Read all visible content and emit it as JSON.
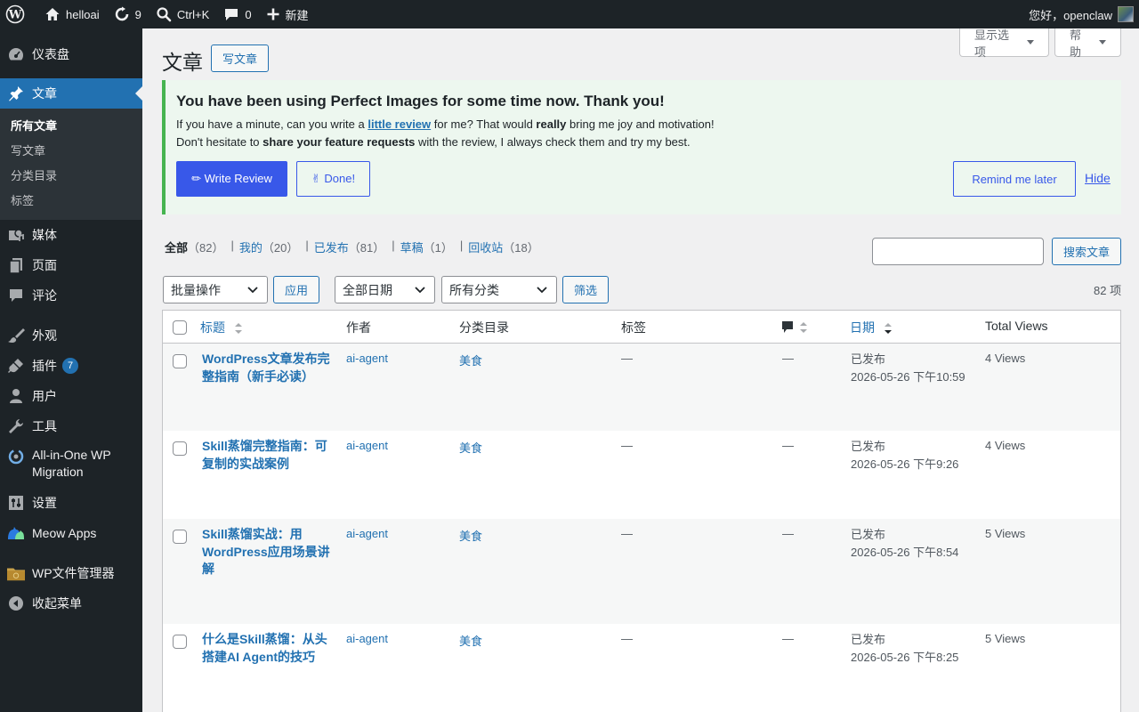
{
  "adminbar": {
    "site_name": "helloai",
    "updates_count": "9",
    "search_shortcut": "Ctrl+K",
    "comments_count": "0",
    "new_label": "新建",
    "greeting": "您好，openclaw"
  },
  "sidebar": {
    "dashboard": "仪表盘",
    "posts": "文章",
    "submenu": [
      "所有文章",
      "写文章",
      "分类目录",
      "标签"
    ],
    "media": "媒体",
    "pages": "页面",
    "comments": "评论",
    "appearance": "外观",
    "plugins": "插件",
    "plugins_badge": "7",
    "users": "用户",
    "tools": "工具",
    "migration_line1": "All-in-One WP",
    "migration_line2": "Migration",
    "settings": "设置",
    "meow": "Meow Apps",
    "file_manager": "WP文件管理器",
    "collapse": "收起菜单"
  },
  "header": {
    "screen_options": "显示选项",
    "help": "帮助",
    "title": "文章",
    "add_new": "写文章"
  },
  "notice": {
    "title": "You have been using Perfect Images for some time now. Thank you! ",
    "line1_pre": "If you have a minute, can you write a ",
    "line1_link": "little review",
    "line1_mid": " for me? That would ",
    "line1_bold": "really",
    "line1_post": " bring me joy and motivation! ",
    "line2_pre": "Don't hesitate to ",
    "line2_bold": "share your feature requests",
    "line2_post": " with the review, I always check them and try my best.",
    "write_review": "✏ Write Review",
    "done": "✌ Done!",
    "remind": " Remind me later",
    "hide": "Hide"
  },
  "views": [
    {
      "label": "全部",
      "count": "（82）"
    },
    {
      "label": "我的",
      "count": "（20）"
    },
    {
      "label": "已发布",
      "count": "（81）"
    },
    {
      "label": "草稿",
      "count": "（1）"
    },
    {
      "label": "回收站",
      "count": "（18）"
    }
  ],
  "search_button": "搜索文章",
  "filters": {
    "bulk": "批量操作",
    "apply": "应用",
    "dates": "全部日期",
    "categories": "所有分类",
    "filter": "筛选",
    "items": "82 项"
  },
  "columns": {
    "title": "标题",
    "author": "作者",
    "categories": "分类目录",
    "tags": "标签",
    "date": "日期",
    "views": "Total Views"
  },
  "rows": [
    {
      "title": "WordPress文章发布完整指南（新手必读）",
      "author": "ai-agent",
      "category": "美食",
      "tags": "—",
      "comments": "—",
      "status": "已发布",
      "date": "2026-05-26 下午10:59",
      "views": "4 Views"
    },
    {
      "title": "Skill蒸馏完整指南：可复制的实战案例",
      "author": "ai-agent",
      "category": "美食",
      "tags": "—",
      "comments": "—",
      "status": "已发布",
      "date": "2026-05-26 下午9:26",
      "views": "4 Views"
    },
    {
      "title": "Skill蒸馏实战：用WordPress应用场景讲解",
      "author": "ai-agent",
      "category": "美食",
      "tags": "—",
      "comments": "—",
      "status": "已发布",
      "date": "2026-05-26 下午8:54",
      "views": "5 Views"
    },
    {
      "title": "什么是Skill蒸馏：从头搭建AI Agent的技巧",
      "author": "ai-agent",
      "category": "美食",
      "tags": "—",
      "comments": "—",
      "status": "已发布",
      "date": "2026-05-26 下午8:25",
      "views": "5 Views"
    }
  ]
}
